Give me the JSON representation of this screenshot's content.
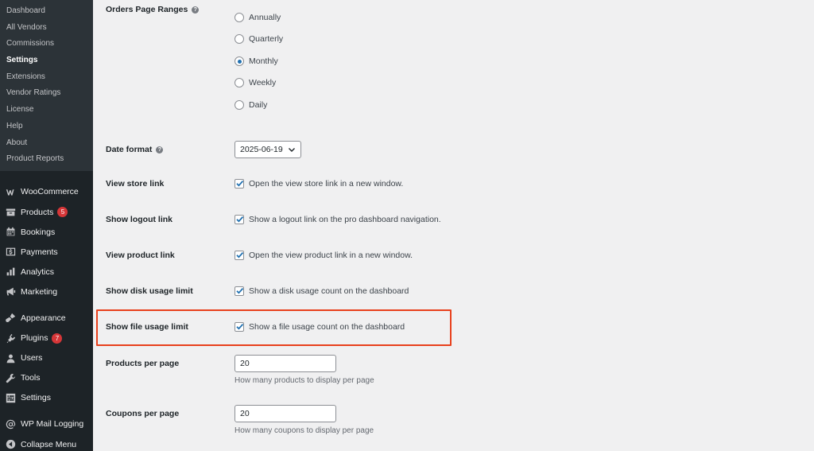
{
  "sidebar": {
    "submenu": [
      {
        "label": "Dashboard"
      },
      {
        "label": "All Vendors"
      },
      {
        "label": "Commissions"
      },
      {
        "label": "Settings"
      },
      {
        "label": "Extensions"
      },
      {
        "label": "Vendor Ratings"
      },
      {
        "label": "License"
      },
      {
        "label": "Help"
      },
      {
        "label": "About"
      },
      {
        "label": "Product Reports"
      }
    ],
    "menu": [
      {
        "label": "WooCommerce",
        "icon": "woo-icon"
      },
      {
        "label": "Products",
        "icon": "products-icon",
        "badge": "5"
      },
      {
        "label": "Bookings",
        "icon": "bookings-icon"
      },
      {
        "label": "Payments",
        "icon": "payments-icon"
      },
      {
        "label": "Analytics",
        "icon": "analytics-icon"
      },
      {
        "label": "Marketing",
        "icon": "marketing-icon"
      },
      {
        "label": "Appearance",
        "icon": "appearance-icon"
      },
      {
        "label": "Plugins",
        "icon": "plugins-icon",
        "badge": "7"
      },
      {
        "label": "Users",
        "icon": "users-icon"
      },
      {
        "label": "Tools",
        "icon": "tools-icon"
      },
      {
        "label": "Settings",
        "icon": "settings-icon"
      },
      {
        "label": "WP Mail Logging",
        "icon": "at-icon"
      },
      {
        "label": "Collapse Menu",
        "icon": "collapse-icon"
      }
    ]
  },
  "settings": {
    "orders_page_ranges": {
      "label": "Orders Page Ranges",
      "options": [
        "Annually",
        "Quarterly",
        "Monthly",
        "Weekly",
        "Daily"
      ],
      "selected": "Monthly"
    },
    "date_format": {
      "label": "Date format",
      "value": "2025-06-19"
    },
    "view_store_link": {
      "label": "View store link",
      "text": "Open the view store link in a new window.",
      "checked": true
    },
    "show_logout_link": {
      "label": "Show logout link",
      "text": "Show a logout link on the pro dashboard navigation.",
      "checked": true
    },
    "view_product_link": {
      "label": "View product link",
      "text": "Open the view product link in a new window.",
      "checked": true
    },
    "show_disk_usage_limit": {
      "label": "Show disk usage limit",
      "text": "Show a disk usage count on the dashboard",
      "checked": true
    },
    "show_file_usage_limit": {
      "label": "Show file usage limit",
      "text": "Show a file usage count on the dashboard",
      "checked": true
    },
    "products_per_page": {
      "label": "Products per page",
      "value": "20",
      "description": "How many products to display per page"
    },
    "coupons_per_page": {
      "label": "Coupons per page",
      "value": "20",
      "description": "How many coupons to display per page"
    }
  },
  "colors": {
    "sidebar_bg": "#1d2327",
    "accent": "#2271b1",
    "highlight_border": "#e8401c",
    "badge": "#d63638"
  }
}
